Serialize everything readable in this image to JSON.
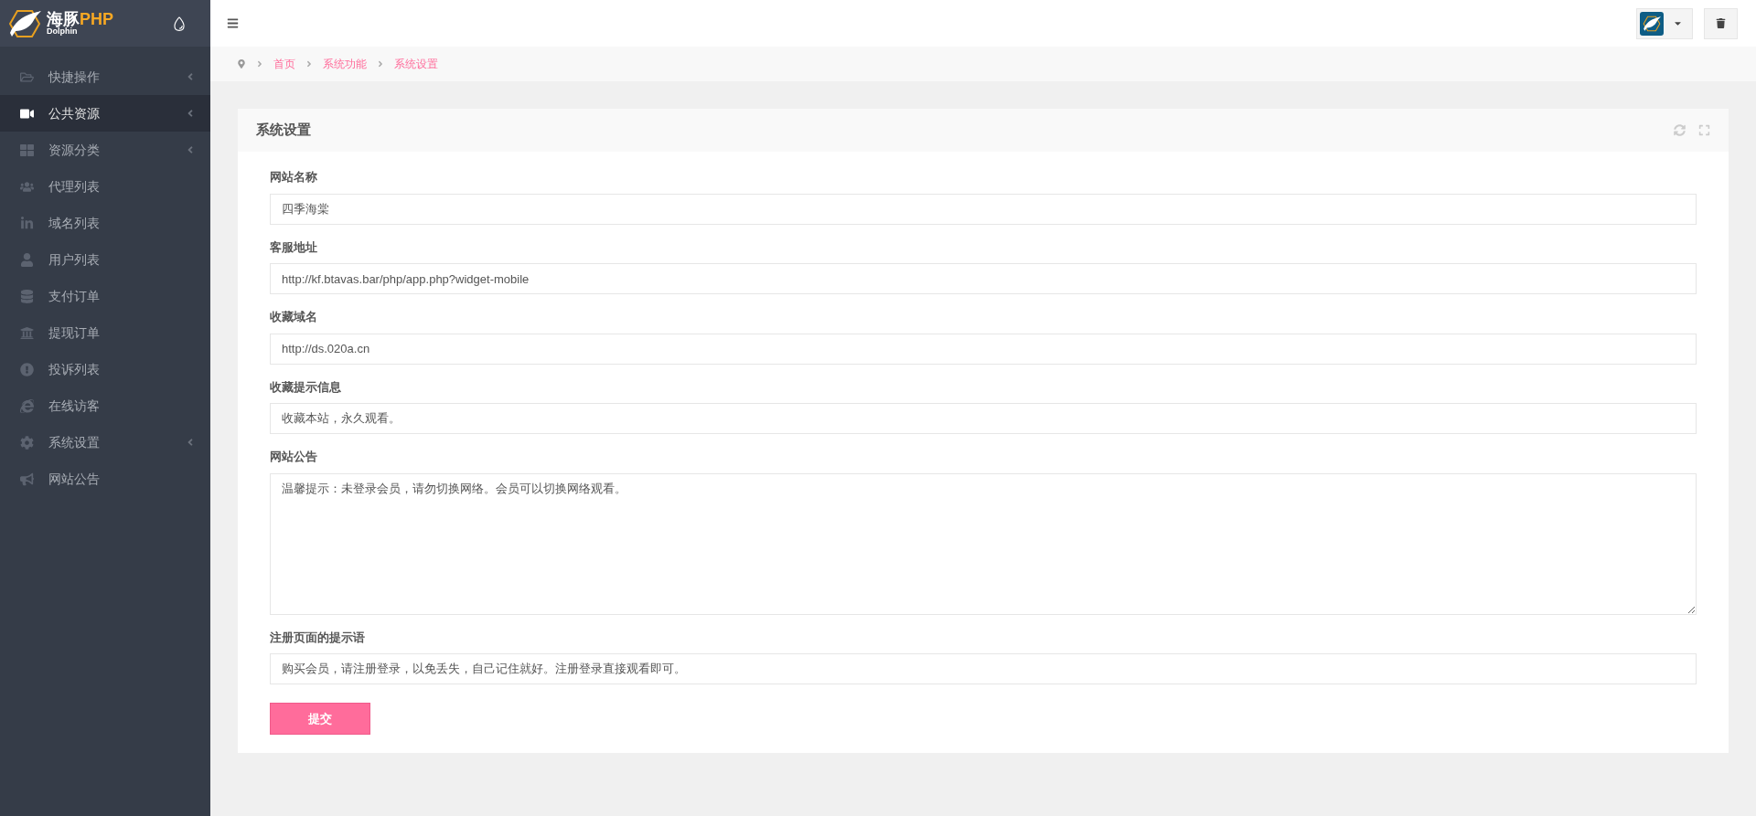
{
  "logo": {
    "name": "海豚",
    "accent": "PHP",
    "sub": "Dolphin"
  },
  "sidebar": {
    "items": [
      {
        "label": "快捷操作",
        "selected": false,
        "expandable": true
      },
      {
        "label": "公共资源",
        "selected": true,
        "expandable": true
      },
      {
        "label": "资源分类",
        "selected": false,
        "expandable": true
      },
      {
        "label": "代理列表",
        "selected": false,
        "expandable": false
      },
      {
        "label": "域名列表",
        "selected": false,
        "expandable": false
      },
      {
        "label": "用户列表",
        "selected": false,
        "expandable": false
      },
      {
        "label": "支付订单",
        "selected": false,
        "expandable": false
      },
      {
        "label": "提现订单",
        "selected": false,
        "expandable": false
      },
      {
        "label": "投诉列表",
        "selected": false,
        "expandable": false
      },
      {
        "label": "在线访客",
        "selected": false,
        "expandable": false
      },
      {
        "label": "系统设置",
        "selected": false,
        "expandable": true
      },
      {
        "label": "网站公告",
        "selected": false,
        "expandable": false
      }
    ]
  },
  "breadcrumb": [
    "首页",
    "系统功能",
    "系统设置"
  ],
  "card": {
    "title": "系统设置",
    "fields": [
      {
        "kind": "input",
        "label": "网站名称",
        "value": "四季海棠"
      },
      {
        "kind": "input",
        "label": "客服地址",
        "value": "http://kf.btavas.bar/php/app.php?widget-mobile"
      },
      {
        "kind": "input",
        "label": "收藏域名",
        "value": "http://ds.020a.cn"
      },
      {
        "kind": "input",
        "label": "收藏提示信息",
        "value": "收藏本站，永久观看。"
      },
      {
        "kind": "textarea",
        "label": "网站公告",
        "value": "温馨提示：未登录会员，请勿切换网络。会员可以切换网络观看。"
      },
      {
        "kind": "input",
        "label": "注册页面的提示语",
        "value": "购买会员，请注册登录，以免丢失，自己记住就好。注册登录直接观看即可。"
      }
    ],
    "submit": "提交"
  }
}
